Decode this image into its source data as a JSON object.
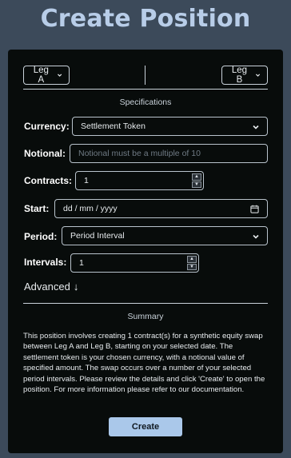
{
  "header": {
    "title": "Create Position"
  },
  "legs": {
    "leg_a_label": "Leg A",
    "leg_b_label": "Leg B"
  },
  "specifications": {
    "heading": "Specifications",
    "currency": {
      "label": "Currency:",
      "value": "Settlement Token"
    },
    "notional": {
      "label": "Notional:",
      "placeholder": "Notional must be a multiple of 10"
    },
    "contracts": {
      "label": "Contracts:",
      "value": "1"
    },
    "start": {
      "label": "Start:",
      "value": "dd / mm / yyyy"
    },
    "period": {
      "label": "Period:",
      "value": "Period Interval"
    },
    "intervals": {
      "label": "Intervals:",
      "value": "1"
    },
    "advanced_label": "Advanced",
    "advanced_arrow": "↓"
  },
  "summary": {
    "heading": "Summary",
    "text": "This position involves creating 1 contract(s) for a synthetic equity swap between Leg A and Leg B, starting on your selected date. The settlement token is your chosen currency, with a notional value of specified amount. The swap occurs over a number of your selected period intervals. Please review the details and click 'Create' to open the position. For more information please refer to our documentation."
  },
  "actions": {
    "create_label": "Create"
  },
  "colors": {
    "background": "#3c4a5a",
    "card": "#080c0b",
    "title": "#b8cde8",
    "accent_button": "#aac8ea"
  },
  "icons": {
    "dropdown": "chevron-down-icon",
    "date": "calendar-icon",
    "spinner": "spinner-arrows-icon"
  }
}
